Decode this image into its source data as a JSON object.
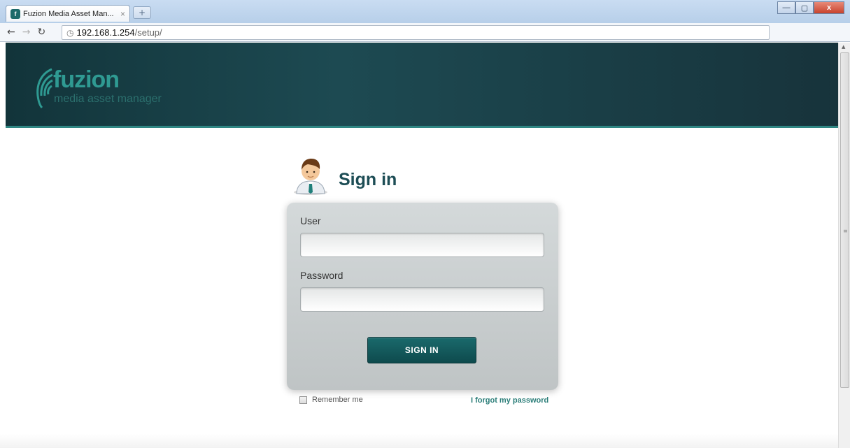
{
  "browser": {
    "tab_title": "Fuzion Media Asset Man...",
    "tab_close": "×",
    "new_tab": "+",
    "url_host": "192.168.1.254",
    "url_path": "/setup/",
    "window_controls": {
      "minimize": "—",
      "maximize": "▢",
      "close": "x"
    }
  },
  "header": {
    "logo_name": "fuzion",
    "logo_tagline": "media asset manager"
  },
  "signin": {
    "title": "Sign in",
    "user_label": "User",
    "user_value": "",
    "password_label": "Password",
    "password_value": "",
    "button_label": "SIGN IN",
    "remember_label": "Remember me",
    "remember_checked": false,
    "forgot_label": "I forgot my password"
  },
  "colors": {
    "header_bg": "#1d4a52",
    "accent": "#2f9a92",
    "button": "#0e4a4d",
    "link": "#2a7d78"
  }
}
